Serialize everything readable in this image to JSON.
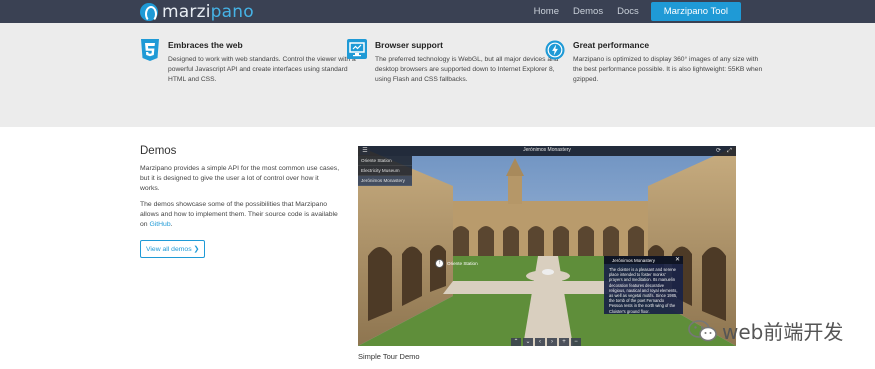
{
  "nav": {
    "logo_main": "marzi",
    "logo_accent": "pano",
    "links": [
      "Home",
      "Demos",
      "Docs"
    ],
    "tool_button": "Marzipano Tool"
  },
  "features": [
    {
      "icon": "html5-icon",
      "title": "Embraces the web",
      "desc": "Designed to work with web standards. Control the viewer with a powerful Javascript API and create interfaces using standard HTML and CSS."
    },
    {
      "icon": "monitor-icon",
      "title": "Browser support",
      "desc": "The preferred technology is WebGL, but all major devices and desktop browsers are supported down to Internet Explorer 8, using Flash and CSS fallbacks."
    },
    {
      "icon": "lightning-icon",
      "title": "Great performance",
      "desc": "Marzipano is optimized to display 360° images of any size with the best performance possible. It is also lightweight: 55KB when gzipped."
    }
  ],
  "demos": {
    "heading": "Demos",
    "para1": "Marzipano provides a simple API for the most common use cases, but it is designed to give the user a lot of control over how it works.",
    "para2_start": "The demos showcase some of the possibilities that Marzipano allows and how to implement them. Their source code is available on ",
    "para2_link": "GitHub",
    "para2_end": ".",
    "button": "View all demos ❯"
  },
  "viewer": {
    "title": "Jerónimos Monastery",
    "scenes": [
      "Oriente Station",
      "Electricity Museum",
      "Jerónimos Monastery"
    ],
    "active_scene": 2,
    "hotspot_label": "Oriente Station",
    "info_title": "Jerónimos Monastery",
    "info_text": "The cloister is a pleasant and serene place intended to foster monks' prayers and meditation. Its manuelin decoration features decorative religious, nautical and royal elements, as well as vegetal motifs. Since 1985, the tomb of the poet Fernando Pessoa rests in the north wing of the Cloister's ground floor.",
    "nav_buttons": [
      "⌃",
      "⌄",
      "‹",
      "›",
      "+",
      "−"
    ]
  },
  "caption": "Simple Tour Demo",
  "watermark": "web前端开发"
}
